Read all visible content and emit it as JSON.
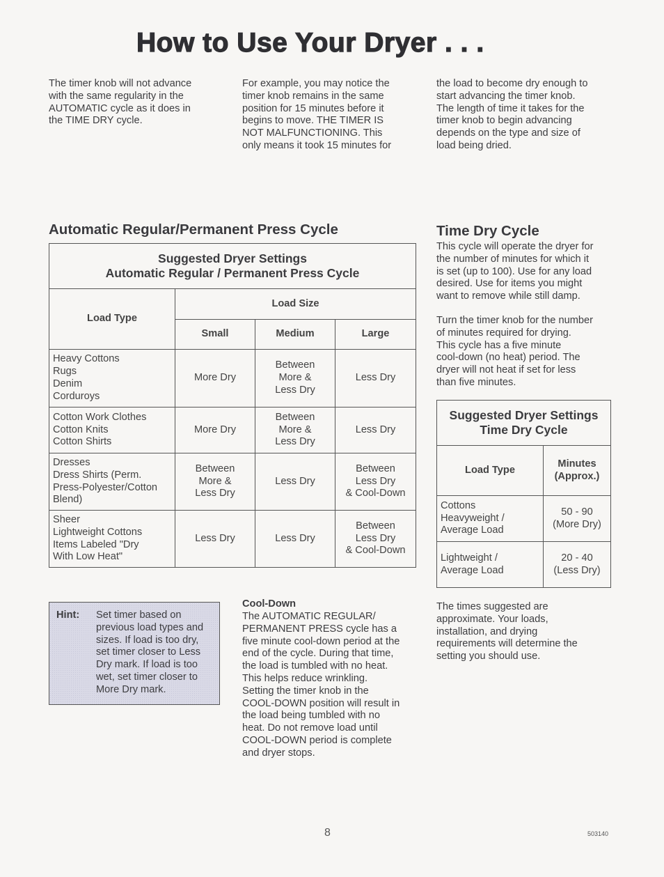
{
  "page": {
    "title": "How to Use Your Dryer . . .",
    "intro": {
      "col1": "The timer knob will not advance\nwith the same regularity in the\nAUTOMATIC cycle as it does in\nthe TIME DRY cycle.",
      "col2": "For example, you may notice the\ntimer knob remains in the same\nposition for 15 minutes before it\nbegins to move. THE TIMER IS\nNOT MALFUNCTIONING. This\nonly means it took 15 minutes for",
      "col3": "the load to become dry enough to\nstart advancing the timer knob.\nThe length of time it takes for the\ntimer knob to begin advancing\ndepends on the type and size of\nload being dried."
    },
    "page_number": "8",
    "doc_code": "503140"
  },
  "auto_section": {
    "heading": "Automatic Regular/Permanent Press Cycle",
    "table": {
      "caption_line1": "Suggested Dryer Settings",
      "caption_line2": "Automatic Regular / Permanent Press Cycle",
      "load_type_header": "Load Type",
      "load_size_header": "Load Size",
      "size_headers": [
        "Small",
        "Medium",
        "Large"
      ],
      "rows": [
        {
          "load_type": "Heavy Cottons\nRugs\nDenim\nCorduroys",
          "small": "More Dry",
          "medium": "Between\nMore &\nLess Dry",
          "large": "Less Dry"
        },
        {
          "load_type": "Cotton Work Clothes\nCotton Knits\nCotton Shirts",
          "small": "More Dry",
          "medium": "Between\nMore &\nLess Dry",
          "large": "Less Dry"
        },
        {
          "load_type": "Dresses\nDress Shirts (Perm.\nPress-Polyester/Cotton\nBlend)",
          "small": "Between\nMore &\nLess Dry",
          "medium": "Less Dry",
          "large": "Between\nLess Dry\n& Cool-Down"
        },
        {
          "load_type": "Sheer\nLightweight Cottons\nItems Labeled \"Dry\nWith Low Heat\"",
          "small": "Less Dry",
          "medium": "Less Dry",
          "large": "Between\nLess Dry\n& Cool-Down"
        }
      ]
    },
    "hint": {
      "label": "Hint:",
      "text": "Set timer based on\nprevious load types and\nsizes. If load is too dry,\nset timer closer to Less\nDry mark. If load is too\nwet, set timer closer to\nMore Dry mark."
    },
    "cooldown": {
      "heading": "Cool-Down",
      "text": "The AUTOMATIC REGULAR/\nPERMANENT PRESS cycle has a\nfive minute cool-down period at the\nend of the cycle. During that time,\nthe load is tumbled with no heat.\nThis helps reduce wrinkling.\nSetting the timer knob in the\nCOOL-DOWN position will result in\nthe load being tumbled with no\nheat. Do not remove load until\nCOOL-DOWN period is complete\nand dryer stops."
    }
  },
  "time_dry_section": {
    "heading": "Time Dry Cycle",
    "para1": "This cycle will operate the dryer for\nthe number of minutes for which it\nis set (up to 100). Use for any load\ndesired. Use for items you might\nwant to remove while still damp.",
    "para2": "Turn the timer knob for the number\nof minutes required for drying.\nThis cycle has a five minute\ncool-down (no heat) period. The\ndryer will not heat if set for less\nthan five minutes.",
    "table": {
      "caption_line1": "Suggested Dryer Settings",
      "caption_line2": "Time Dry Cycle",
      "load_type_header": "Load Type",
      "minutes_header": "Minutes\n(Approx.)",
      "rows": [
        {
          "load_type": "Cottons\nHeavyweight /\nAverage Load",
          "minutes": "50 - 90\n(More Dry)"
        },
        {
          "load_type": "Lightweight /\nAverage Load",
          "minutes": "20 - 40\n(Less Dry)"
        }
      ]
    },
    "note": "The times suggested are\napproximate. Your loads,\ninstallation, and drying\nrequirements will determine the\nsetting you should use."
  }
}
